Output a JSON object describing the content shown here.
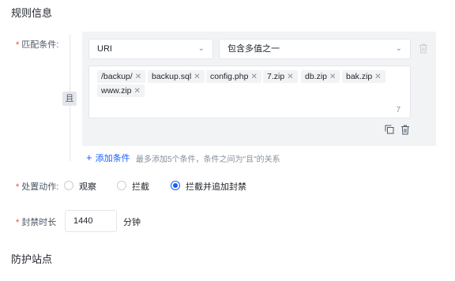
{
  "rule_section": {
    "title": "规则信息"
  },
  "match": {
    "label": "匹配条件:",
    "and_label": "且",
    "field_select": "URI",
    "operator_select": "包含多值之一",
    "tags": [
      "/backup/",
      "backup.sql",
      "config.php",
      "7.zip",
      "db.zip",
      "bak.zip",
      "www.zip"
    ],
    "count": "7",
    "add_label": "添加条件",
    "hint": "最多添加5个条件，条件之间为\"且\"的关系"
  },
  "action": {
    "label": "处置动作:",
    "options": [
      "观察",
      "拦截",
      "拦截并追加封禁"
    ],
    "selected": "拦截并追加封禁"
  },
  "ban": {
    "label": "封禁时长",
    "value": "1440",
    "unit": "分钟"
  },
  "protect_section": {
    "title": "防护站点"
  },
  "icons": {
    "chevron": "chevron-down-icon",
    "delete": "trash-icon",
    "copy": "copy-icon",
    "add": "plus-icon"
  },
  "colors": {
    "primary": "#165dff",
    "required": "#f53f3f",
    "panel": "#f2f3f5"
  }
}
